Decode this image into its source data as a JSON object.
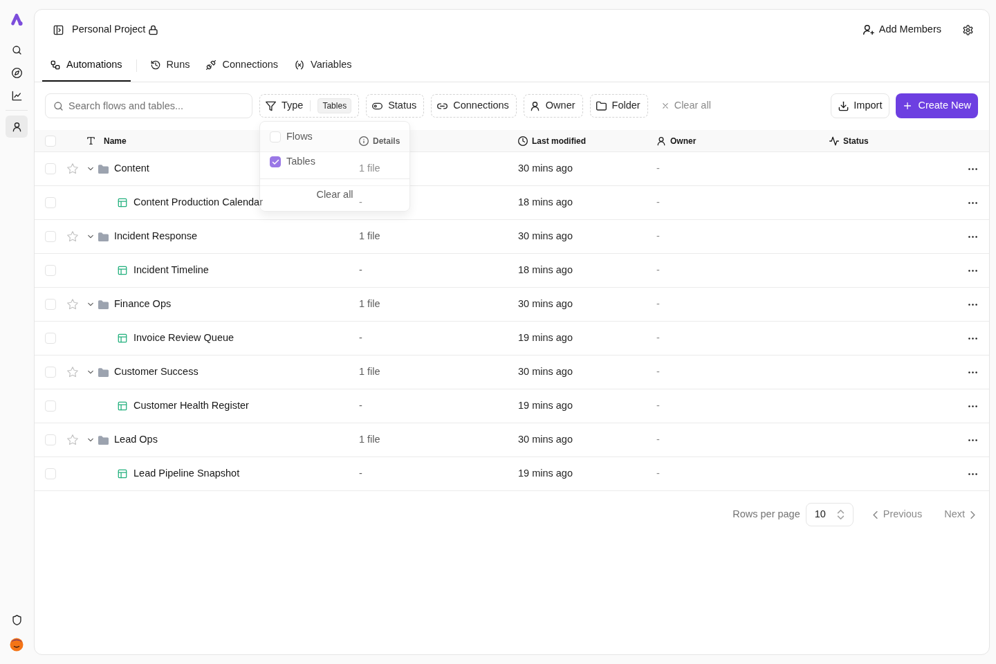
{
  "sidebar": {
    "nav": [
      {
        "selected": false
      },
      {
        "selected": false
      },
      {
        "selected": false
      },
      {
        "selected": true
      }
    ]
  },
  "project": {
    "title": "Personal Project",
    "locked": true
  },
  "add_members": "Add Members",
  "tabs": [
    {
      "label": "Automations",
      "selected": true
    },
    {
      "label": "Runs",
      "selected": false
    },
    {
      "label": "Connections",
      "selected": false
    },
    {
      "label": "Variables",
      "selected": false
    }
  ],
  "search": {
    "placeholder": "Search flows and tables..."
  },
  "filters": [
    {
      "label": "Type",
      "value": "Tables",
      "menu": {
        "options": [
          {
            "label": "Flows",
            "checked": false
          },
          {
            "label": "Tables",
            "checked": true
          }
        ],
        "clear": "Clear all"
      }
    },
    {
      "label": "Status"
    },
    {
      "label": "Connections"
    },
    {
      "label": "Owner"
    },
    {
      "label": "Folder"
    }
  ],
  "clear_filters": "Clear all",
  "import_button": "Import",
  "create_button": "Create New",
  "table": {
    "select_all": false,
    "columns": [
      "Name",
      "Details",
      "Last modified",
      "Owner",
      "Status"
    ],
    "rows": [
      {
        "name": "Content",
        "files": "1 file",
        "modified": "30 mins ago",
        "owner": "-",
        "checked": false,
        "starred": false,
        "expanded": true,
        "children": [
          {
            "name": "Content Production Calendar",
            "files": "-",
            "modified": "18 mins ago",
            "owner": "-",
            "checked": false
          }
        ]
      },
      {
        "name": "Incident Response",
        "files": "1 file",
        "modified": "30 mins ago",
        "owner": "-",
        "checked": false,
        "starred": false,
        "expanded": true,
        "children": [
          {
            "name": "Incident Timeline",
            "files": "-",
            "modified": "18 mins ago",
            "owner": "-",
            "checked": false
          }
        ]
      },
      {
        "name": "Finance Ops",
        "files": "1 file",
        "modified": "30 mins ago",
        "owner": "-",
        "checked": false,
        "starred": false,
        "expanded": true,
        "children": [
          {
            "name": "Invoice Review Queue",
            "files": "-",
            "modified": "19 mins ago",
            "owner": "-",
            "checked": false
          }
        ]
      },
      {
        "name": "Customer Success",
        "files": "1 file",
        "modified": "30 mins ago",
        "owner": "-",
        "checked": false,
        "starred": false,
        "expanded": true,
        "children": [
          {
            "name": "Customer Health Register",
            "files": "-",
            "modified": "19 mins ago",
            "owner": "-",
            "checked": false
          }
        ]
      },
      {
        "name": "Lead Ops",
        "files": "1 file",
        "modified": "30 mins ago",
        "owner": "-",
        "checked": false,
        "starred": false,
        "expanded": true,
        "children": [
          {
            "name": "Lead Pipeline Snapshot",
            "files": "-",
            "modified": "19 mins ago",
            "owner": "-",
            "checked": false
          }
        ]
      }
    ]
  },
  "pagination": {
    "label": "Rows per page",
    "page_size": "10",
    "previous": {
      "label": "Previous",
      "disabled": true
    },
    "next": {
      "label": "Next",
      "disabled": true
    }
  }
}
